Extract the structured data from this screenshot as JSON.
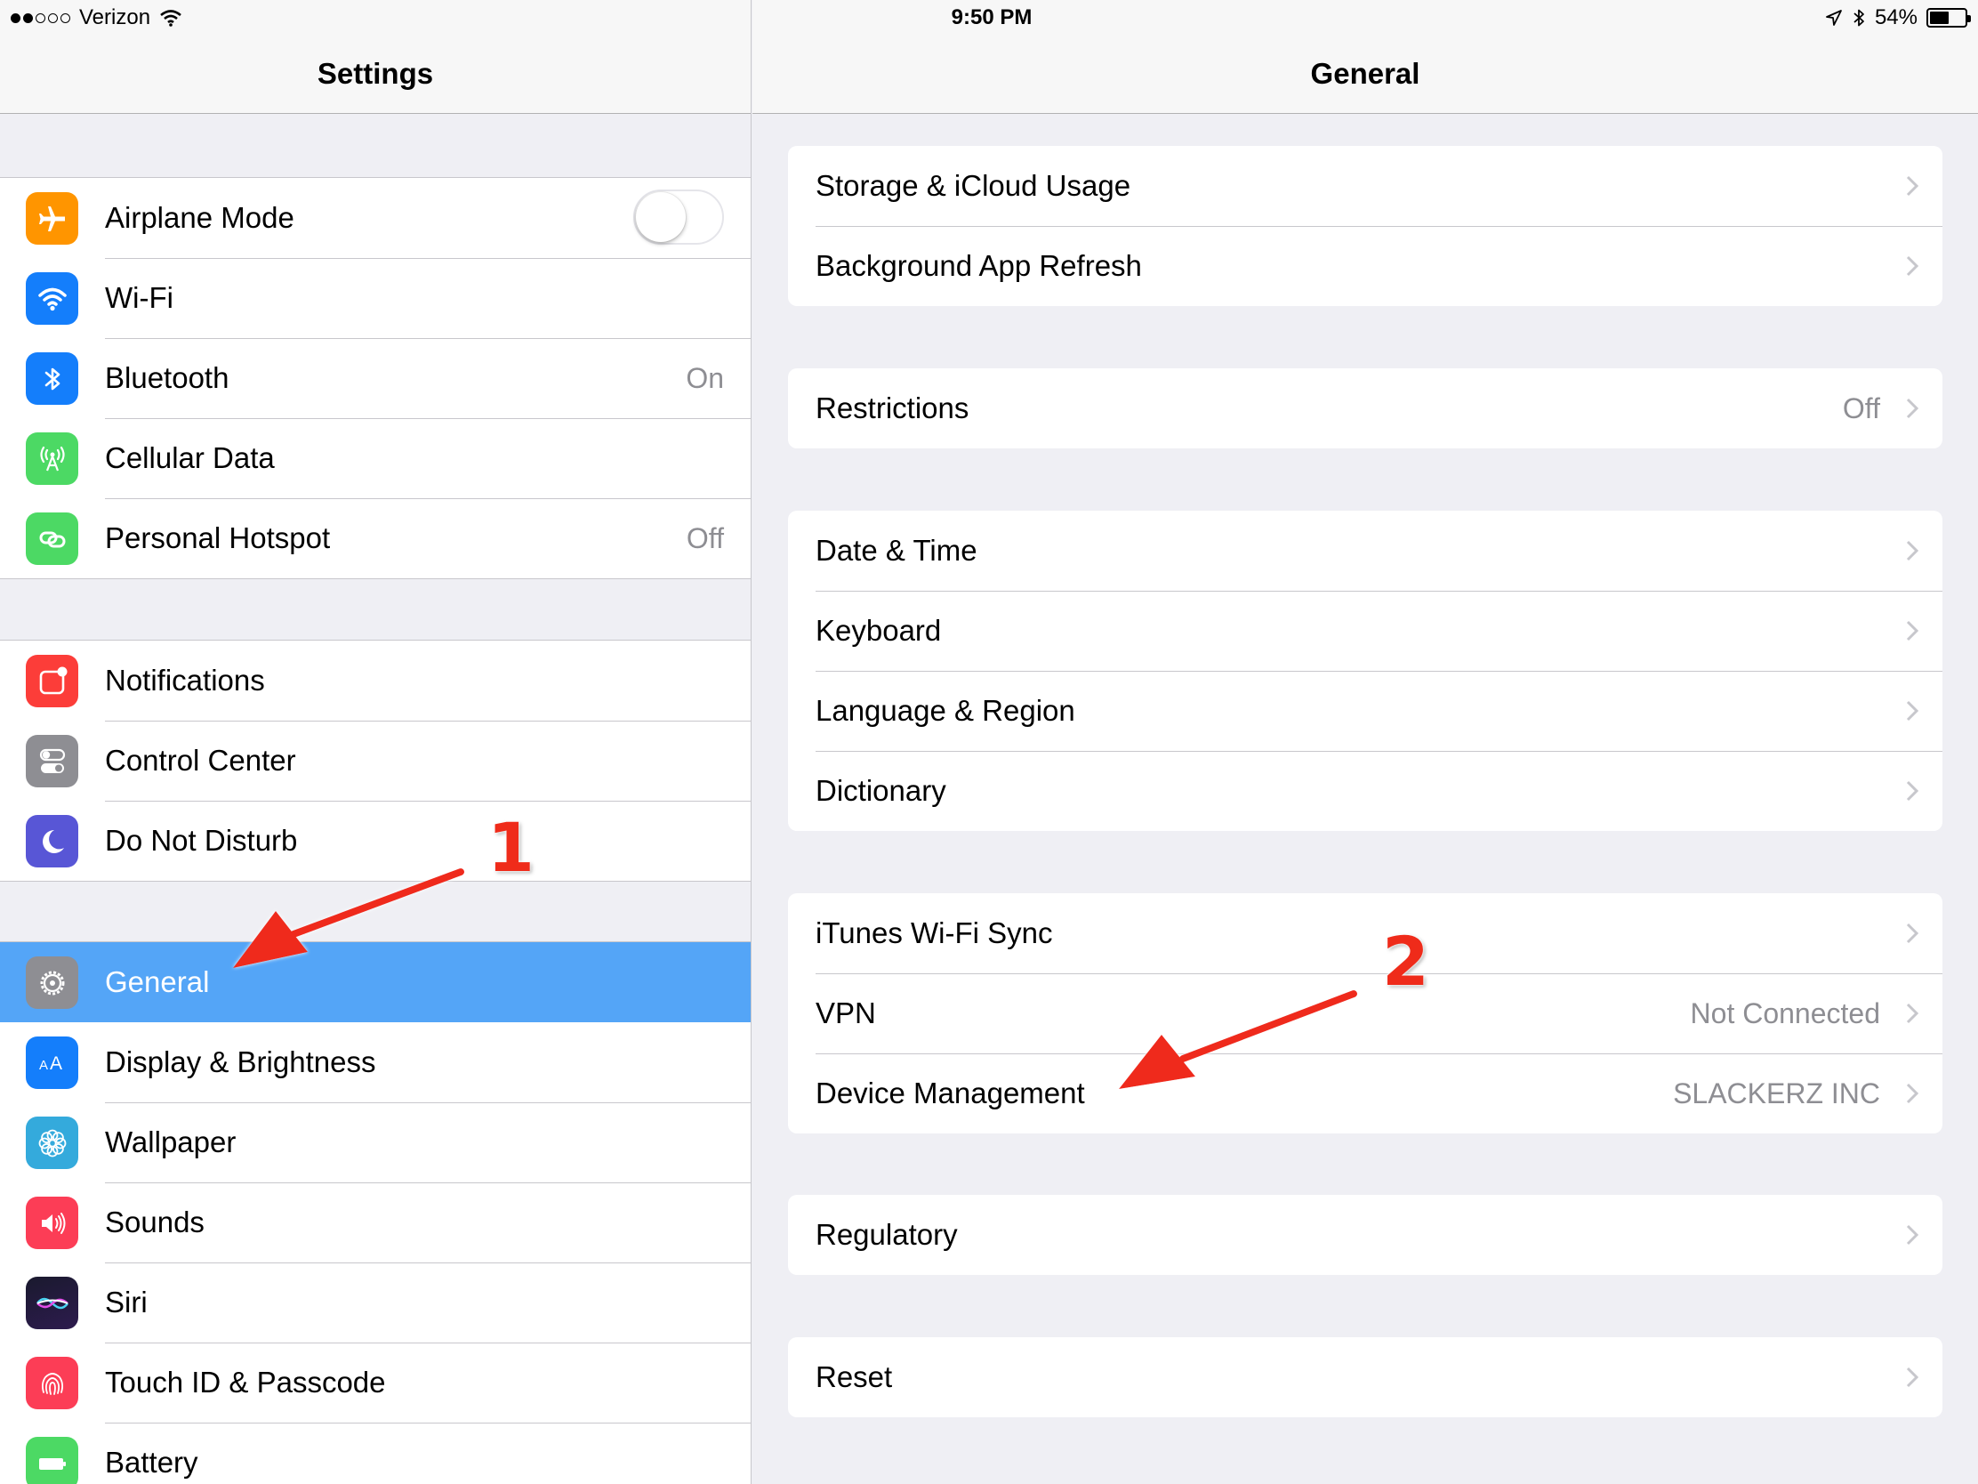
{
  "status_bar": {
    "carrier": "Verizon",
    "time": "9:50 PM",
    "battery": "54%",
    "battery_level": 0.54
  },
  "master": {
    "title": "Settings",
    "groups": [
      [
        {
          "label": "Airplane Mode",
          "icon": "airplane-icon",
          "color": "#ff9500",
          "toggle": false
        },
        {
          "label": "Wi-Fi",
          "icon": "wifi-icon",
          "color": "#147efb"
        },
        {
          "label": "Bluetooth",
          "icon": "bluetooth-icon",
          "color": "#147efb",
          "value": "On"
        },
        {
          "label": "Cellular Data",
          "icon": "cellular-antenna-icon",
          "color": "#4cd964"
        },
        {
          "label": "Personal Hotspot",
          "icon": "hotspot-icon",
          "color": "#4cd964",
          "value": "Off"
        }
      ],
      [
        {
          "label": "Notifications",
          "icon": "notifications-icon",
          "color": "#fc3d39"
        },
        {
          "label": "Control Center",
          "icon": "control-center-icon",
          "color": "#8e8e93"
        },
        {
          "label": "Do Not Disturb",
          "icon": "moon-icon",
          "color": "#5856d6"
        }
      ],
      [
        {
          "label": "General",
          "icon": "gear-icon",
          "color": "#8e8e93",
          "selected": true
        },
        {
          "label": "Display & Brightness",
          "icon": "display-text-icon",
          "color": "#147efb"
        },
        {
          "label": "Wallpaper",
          "icon": "wallpaper-flower-icon",
          "color": "#34aadc"
        },
        {
          "label": "Sounds",
          "icon": "speaker-icon",
          "color": "#fc3d56"
        },
        {
          "label": "Siri",
          "icon": "siri-icon",
          "color": "#1c1c1e"
        },
        {
          "label": "Touch ID & Passcode",
          "icon": "fingerprint-icon",
          "color": "#fc3d56"
        },
        {
          "label": "Battery",
          "icon": "battery-icon",
          "color": "#4cd964"
        }
      ]
    ]
  },
  "detail": {
    "title": "General",
    "groups": [
      [
        {
          "label": "Storage & iCloud Usage"
        },
        {
          "label": "Background App Refresh"
        }
      ],
      [
        {
          "label": "Restrictions",
          "value": "Off"
        }
      ],
      [
        {
          "label": "Date & Time"
        },
        {
          "label": "Keyboard"
        },
        {
          "label": "Language & Region"
        },
        {
          "label": "Dictionary"
        }
      ],
      [
        {
          "label": "iTunes Wi-Fi Sync"
        },
        {
          "label": "VPN",
          "value": "Not Connected"
        },
        {
          "label": "Device Management",
          "value": "SLACKERZ INC"
        }
      ],
      [
        {
          "label": "Regulatory"
        }
      ],
      [
        {
          "label": "Reset"
        }
      ]
    ]
  },
  "annotations": {
    "step1": "1",
    "step2": "2",
    "arrow_color": "#ef2b1a"
  }
}
